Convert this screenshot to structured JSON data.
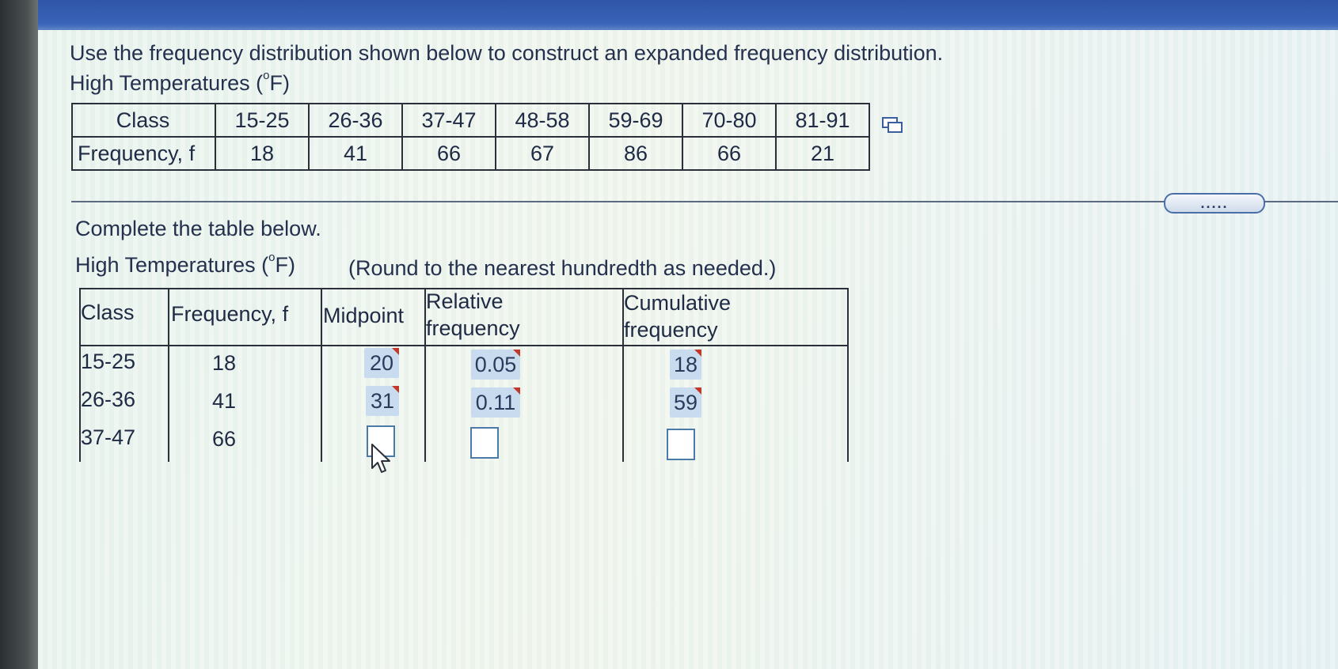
{
  "question": "Use the frequency distribution shown below to construct an expanded frequency distribution.",
  "given_table": {
    "title": "High Temperatures (°F)",
    "title_base": "High Temperatures (",
    "title_deg": "o",
    "title_unit": "F)",
    "class_label": "Class",
    "frequency_label": "Frequency, f",
    "classes": [
      "15-25",
      "26-36",
      "37-47",
      "48-58",
      "59-69",
      "70-80",
      "81-91"
    ],
    "frequencies": [
      "18",
      "41",
      "66",
      "67",
      "86",
      "66",
      "21"
    ]
  },
  "expand_button_label": ".....",
  "instruction": "Complete the table below.",
  "answer_table": {
    "title_base": "High Temperatures (",
    "title_deg": "o",
    "title_unit": "F)",
    "round_note": "(Round to the nearest hundredth as needed.)",
    "headers": {
      "class": "Class",
      "frequency": "Frequency, f",
      "midpoint": "Midpoint",
      "relative_1": "Relative",
      "relative_2": "frequency",
      "cumulative_1": "Cumulative",
      "cumulative_2": "frequency"
    },
    "rows": [
      {
        "class": "15-25",
        "frequency": "18",
        "midpoint": "20",
        "relative": "0.05",
        "cumulative": "18"
      },
      {
        "class": "26-36",
        "frequency": "41",
        "midpoint": "31",
        "relative": "0.11",
        "cumulative": "59"
      },
      {
        "class": "37-47",
        "frequency": "66",
        "midpoint": "",
        "relative": "",
        "cumulative": ""
      }
    ]
  }
}
